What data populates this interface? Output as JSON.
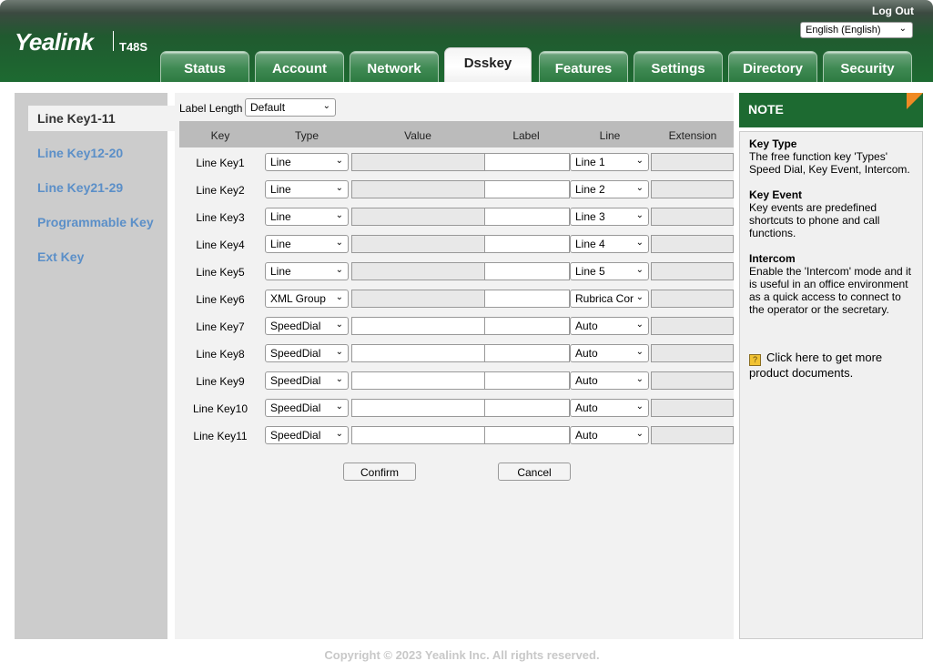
{
  "header": {
    "brand": "Yealink",
    "model": "T48S",
    "logout": "Log Out",
    "language": "English (English)"
  },
  "tabs": [
    "Status",
    "Account",
    "Network",
    "Dsskey",
    "Features",
    "Settings",
    "Directory",
    "Security"
  ],
  "active_tab": "Dsskey",
  "sidebar": {
    "items": [
      "Line Key1-11",
      "Line Key12-20",
      "Line Key21-29",
      "Programmable Key",
      "Ext Key"
    ]
  },
  "main": {
    "label_length_label": "Label Length",
    "label_length_value": "Default",
    "columns": [
      "Key",
      "Type",
      "Value",
      "Label",
      "Line",
      "Extension"
    ],
    "rows": [
      {
        "key": "Line Key1",
        "type": "Line",
        "value": "",
        "label": "",
        "line": "Line 1",
        "extension": ""
      },
      {
        "key": "Line Key2",
        "type": "Line",
        "value": "",
        "label": "",
        "line": "Line 2",
        "extension": ""
      },
      {
        "key": "Line Key3",
        "type": "Line",
        "value": "",
        "label": "",
        "line": "Line 3",
        "extension": ""
      },
      {
        "key": "Line Key4",
        "type": "Line",
        "value": "",
        "label": "",
        "line": "Line 4",
        "extension": ""
      },
      {
        "key": "Line Key5",
        "type": "Line",
        "value": "",
        "label": "",
        "line": "Line 5",
        "extension": ""
      },
      {
        "key": "Line Key6",
        "type": "XML Group",
        "value": "",
        "label": "",
        "line": "Rubrica Cor",
        "extension": ""
      },
      {
        "key": "Line Key7",
        "type": "SpeedDial",
        "value": "",
        "label": "",
        "line": "Auto",
        "extension": ""
      },
      {
        "key": "Line Key8",
        "type": "SpeedDial",
        "value": "",
        "label": "",
        "line": "Auto",
        "extension": ""
      },
      {
        "key": "Line Key9",
        "type": "SpeedDial",
        "value": "",
        "label": "",
        "line": "Auto",
        "extension": ""
      },
      {
        "key": "Line Key10",
        "type": "SpeedDial",
        "value": "",
        "label": "",
        "line": "Auto",
        "extension": ""
      },
      {
        "key": "Line Key11",
        "type": "SpeedDial",
        "value": "",
        "label": "",
        "line": "Auto",
        "extension": ""
      }
    ],
    "confirm": "Confirm",
    "cancel": "Cancel"
  },
  "note": {
    "title": "NOTE",
    "entries": [
      {
        "term": "Key Type",
        "desc": "The free function key 'Types' Speed Dial, Key Event, Intercom."
      },
      {
        "term": "Key Event",
        "desc": "Key events are predefined shortcuts to phone and call functions."
      },
      {
        "term": "Intercom",
        "desc": "Enable the 'Intercom' mode and it is useful in an office environment as a quick access to connect to the operator or the secretary."
      }
    ],
    "more_docs": "Click here to get more product documents."
  },
  "footer": "Copyright © 2023 Yealink Inc. All rights reserved.",
  "colors": {
    "header_green": "#1d6a31",
    "sidebar_link": "#5b8fc8",
    "note_corner": "#f08a24"
  }
}
